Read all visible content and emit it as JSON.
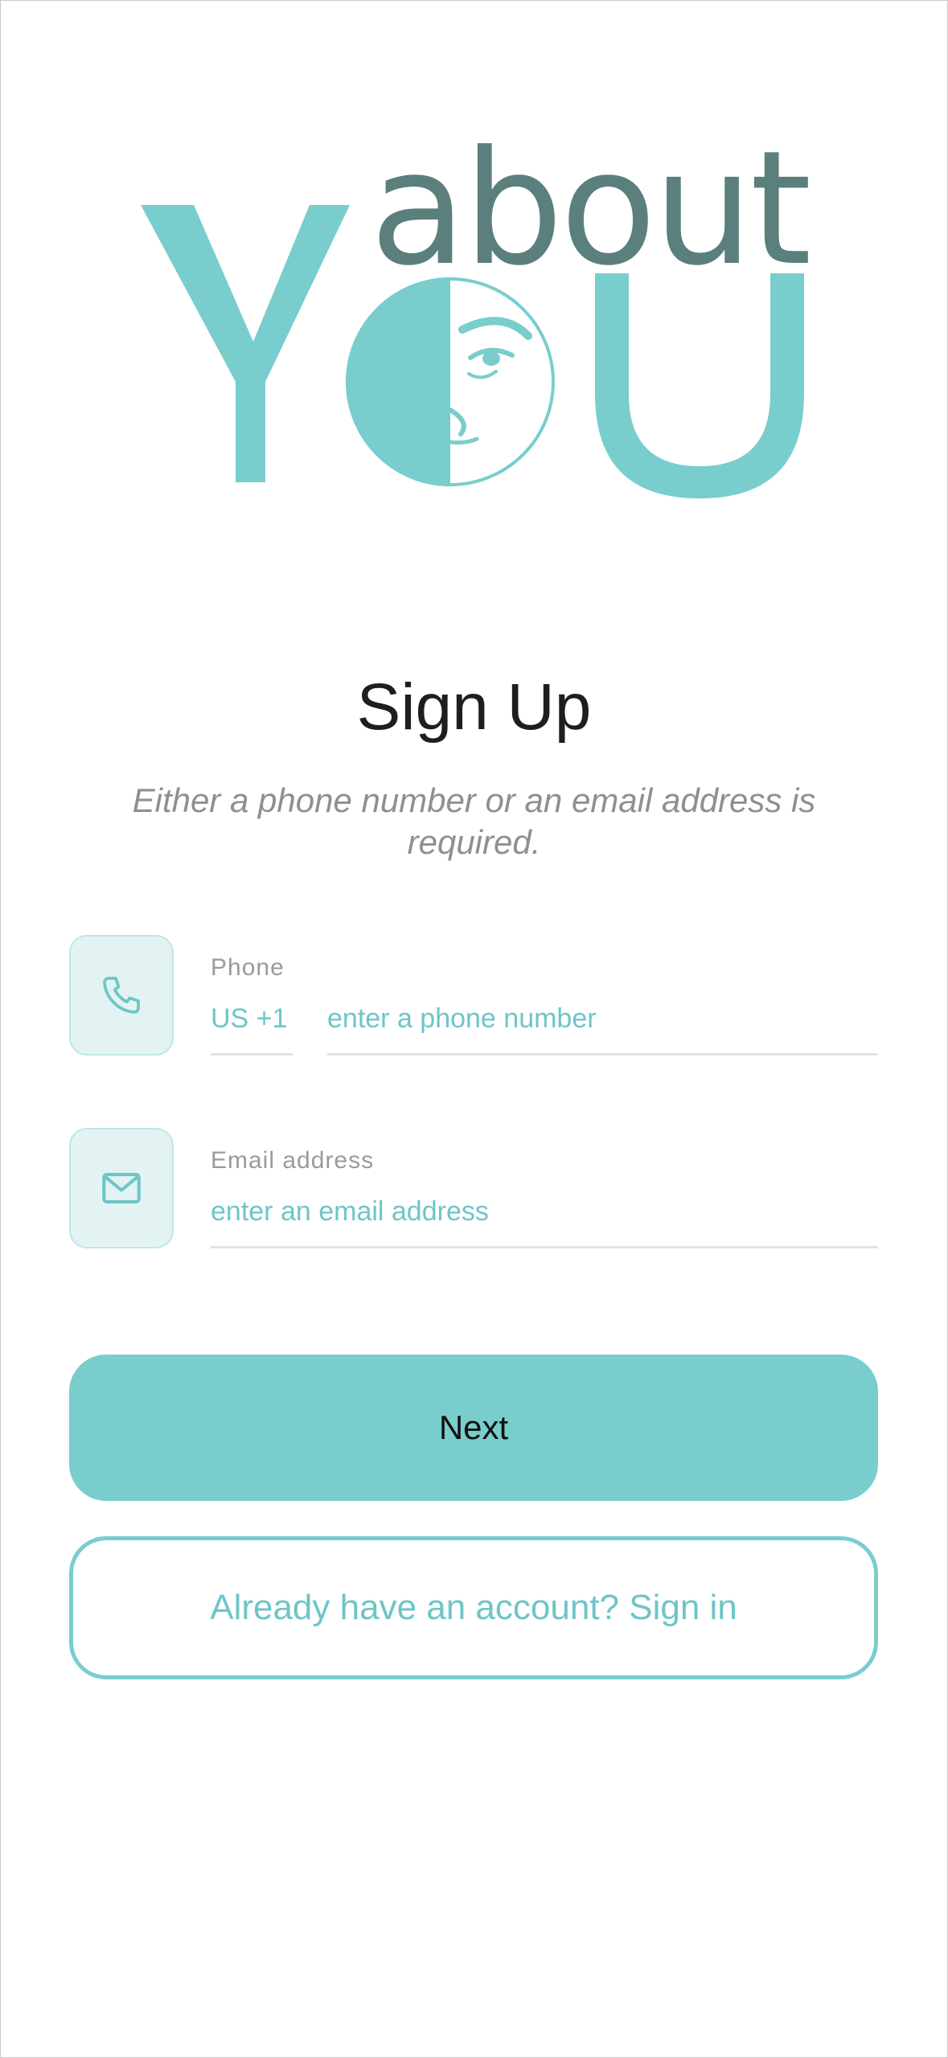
{
  "logo": {
    "top_word": "about",
    "main_word": "YOU",
    "colors": {
      "teal": "#79cdcd",
      "dark_teal": "#5a7f7c"
    }
  },
  "signup": {
    "title": "Sign Up",
    "subtitle": "Either a phone number or an email address is required."
  },
  "phone": {
    "icon": "phone-icon",
    "label": "Phone",
    "country_code": "US +1",
    "placeholder": "enter a phone number"
  },
  "email": {
    "icon": "mail-icon",
    "label": "Email address",
    "placeholder": "enter an email address"
  },
  "buttons": {
    "next_label": "Next",
    "signin_label": "Already have an account? Sign in"
  },
  "colors": {
    "accent": "#79cdcd",
    "accent_text": "#6ec5c7",
    "icon_bg": "#e3f3f4",
    "muted_text": "#8f8f8f"
  }
}
